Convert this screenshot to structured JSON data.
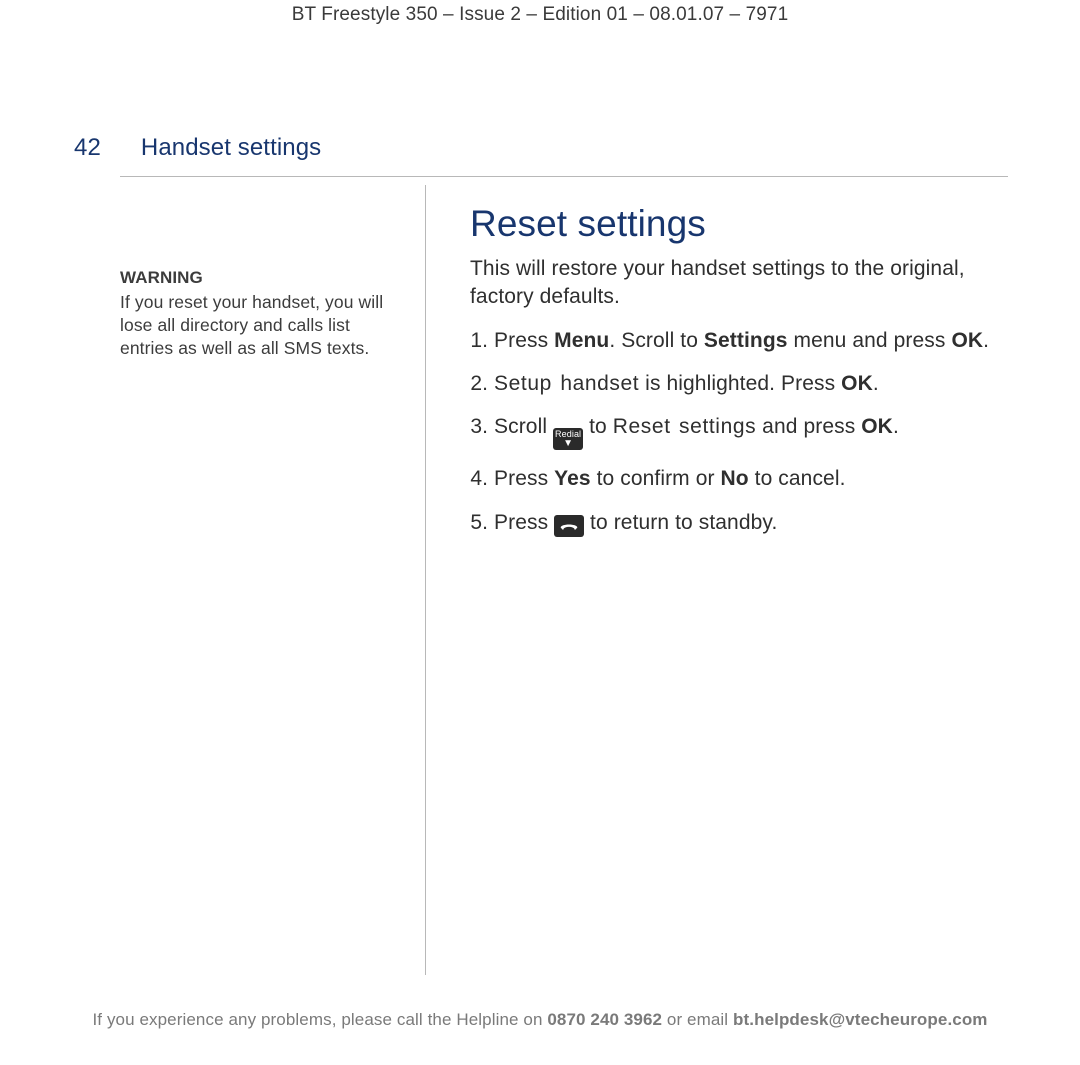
{
  "header": "BT Freestyle 350 – Issue 2 – Edition 01 – 08.01.07 – 7971",
  "page_number": "42",
  "section_title": "Handset settings",
  "sidebar": {
    "warning_label": "WARNING",
    "warning_text": "If you reset your handset, you will lose all directory and calls list entries as well as all SMS texts."
  },
  "main": {
    "heading": "Reset settings",
    "intro": "This will restore your handset settings to the original, factory defaults.",
    "steps": {
      "s1": {
        "a": "Press ",
        "menu": "Menu",
        "b": ". Scroll to ",
        "settings": "Settings",
        "c": " menu and press ",
        "ok": "OK",
        "d": "."
      },
      "s2": {
        "screen": "Setup handset",
        "a": " is highlighted. Press ",
        "ok": "OK",
        "b": "."
      },
      "s3": {
        "a": "Scroll ",
        "b": " to ",
        "screen": "Reset settings",
        "c": " and press ",
        "ok": "OK",
        "d": "."
      },
      "s4": {
        "a": "Press ",
        "yes": "Yes",
        "b": " to confirm or ",
        "no": "No",
        "c": " to cancel."
      },
      "s5": {
        "a": "Press ",
        "b": " to return to standby."
      }
    },
    "icons": {
      "redial_label": "Redial"
    }
  },
  "footer": {
    "a": "If you experience any problems, please call the Helpline on ",
    "phone": "0870 240 3962",
    "b": " or email ",
    "email": "bt.helpdesk@vtecheurope.com"
  }
}
